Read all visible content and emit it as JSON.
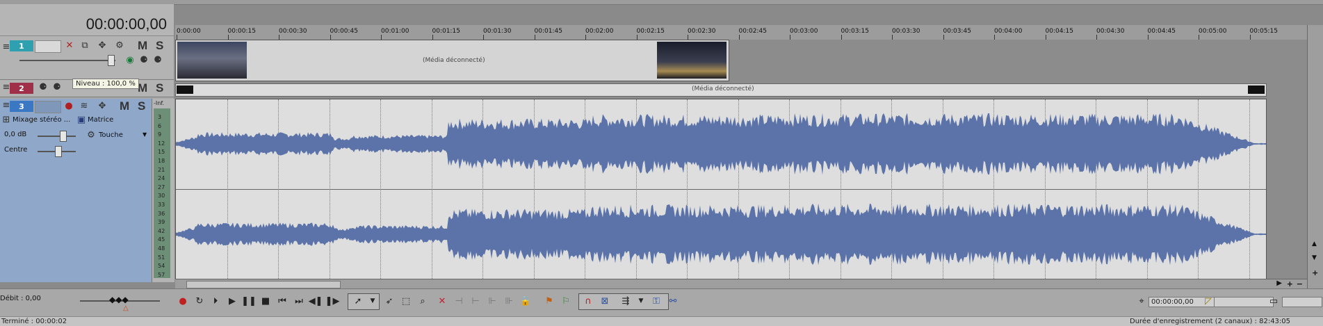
{
  "timecode": "00:00:00,00",
  "ruler": {
    "labels": [
      "0:00:00",
      "00:00:15",
      "00:00:30",
      "00:00:45",
      "00:01:00",
      "00:01:15",
      "00:01:30",
      "00:01:45",
      "00:02:00",
      "00:02:15",
      "00:02:30",
      "00:02:45",
      "00:03:00",
      "00:03:15",
      "00:03:30",
      "00:03:45",
      "00:04:00",
      "00:04:15",
      "00:04:30",
      "00:04:45",
      "00:05:00",
      "00:05:15"
    ]
  },
  "tracks": {
    "video1": {
      "number": "1",
      "mute": "M",
      "solo": "S"
    },
    "video2": {
      "number": "2",
      "mute": "M",
      "solo": "S",
      "tooltip": "Niveau : 100,0 %"
    },
    "audio3": {
      "number": "3",
      "mute": "M",
      "solo": "S",
      "meter_top": "-Inf.",
      "meter_scale": [
        "3",
        "6",
        "9",
        "12",
        "15",
        "18",
        "21",
        "24",
        "27",
        "30",
        "33",
        "36",
        "39",
        "42",
        "45",
        "48",
        "51",
        "54",
        "57"
      ],
      "mix_label": "Mixage stéréo ...",
      "matrix_label": "Matrice",
      "volume": "0,0 dB",
      "touch_label": "Touche",
      "pan": "Centre"
    }
  },
  "clips": {
    "video_media_status": "(Média déconnecté)",
    "video2_media_status": "(Média déconnecté)"
  },
  "transport": {
    "rate_label": "Débit : 0,00",
    "cursor_time": "00:00:00,00"
  },
  "status": {
    "left": "Terminé : 00:00:02",
    "right": "Durée d'enregistrement (2 canaux) : 82:43:05"
  },
  "colors": {
    "waveform": "#5b73a8",
    "audio_header": "#8fa7c8",
    "track1": "#2fa0b0",
    "track2": "#a0304a",
    "track3": "#3a78c4"
  }
}
